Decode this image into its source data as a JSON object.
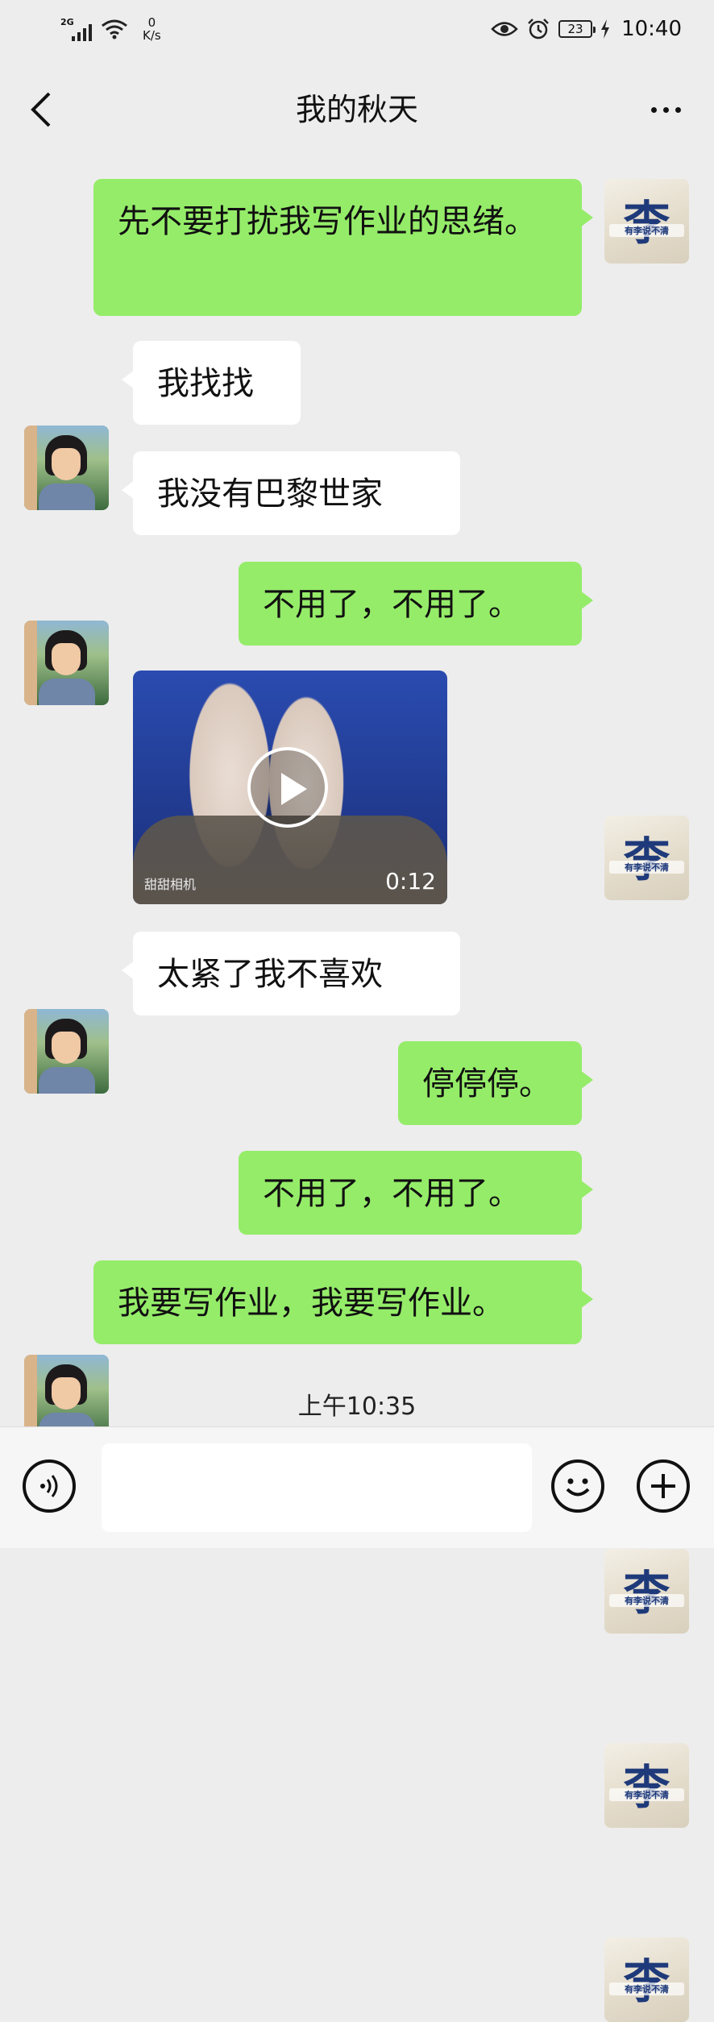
{
  "status_bar": {
    "network": "2G",
    "speed_value": "0",
    "speed_unit": "K/s",
    "battery": "23",
    "time": "10:40"
  },
  "header": {
    "title": "我的秋天",
    "back_icon": "chevron-left-icon",
    "more_icon": "more-dots-icon"
  },
  "avatars": {
    "self_glyph": "李",
    "self_caption": "有李说不清"
  },
  "messages": [
    {
      "from": "self",
      "text": "先不要打扰我写作业的思绪。"
    },
    {
      "from": "other",
      "text": "我找找"
    },
    {
      "from": "other",
      "text": "我没有巴黎世家"
    },
    {
      "from": "self",
      "text": "不用了，不用了。"
    },
    {
      "from": "other",
      "type": "video",
      "duration": "0:12",
      "watermark": "甜甜相机"
    },
    {
      "from": "other",
      "text": "太紧了我不喜欢"
    },
    {
      "from": "self",
      "text": "停停停。"
    },
    {
      "from": "self",
      "text": "不用了，不用了。"
    },
    {
      "from": "self",
      "text": "我要写作业，我要写作业。"
    }
  ],
  "timestamp": "上午10:35",
  "input_bar": {
    "voice_icon": "voice-icon",
    "emoji_icon": "emoji-icon",
    "plus_icon": "plus-icon",
    "placeholder": ""
  }
}
